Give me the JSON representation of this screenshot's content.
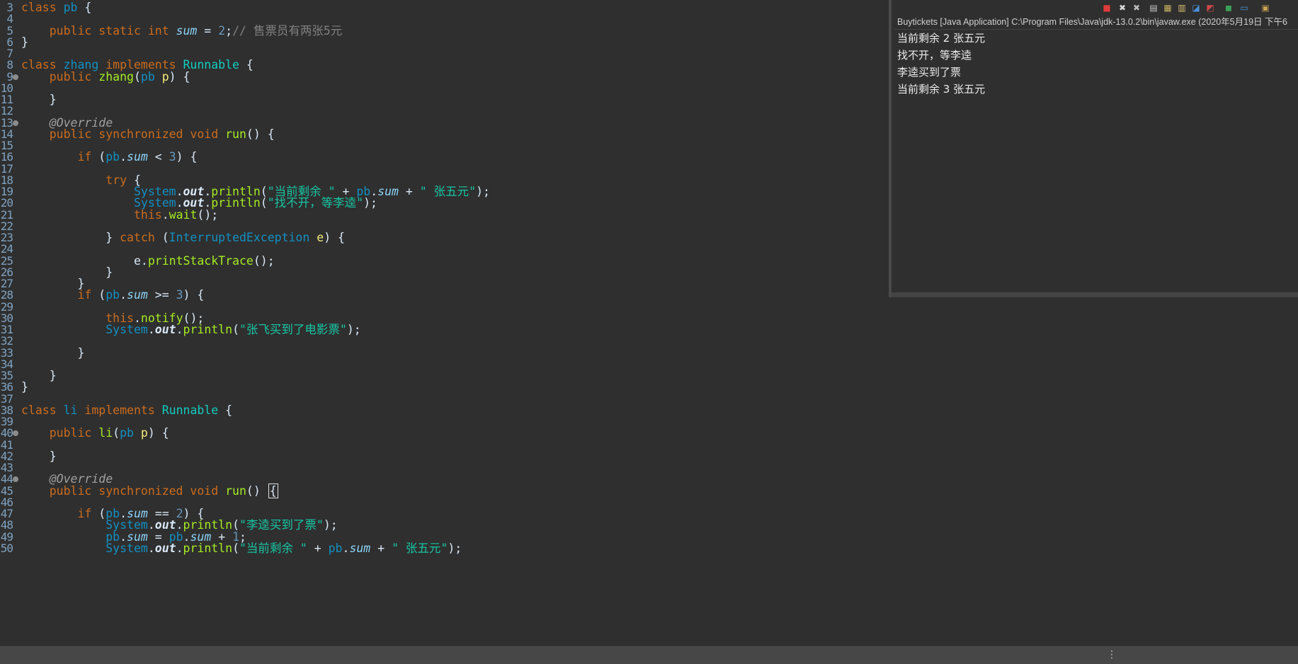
{
  "editor": {
    "lines": [
      {
        "num": "3",
        "marker": false,
        "tokens": [
          [
            "kw",
            "class "
          ],
          [
            "ty",
            "pb"
          ],
          [
            "pl",
            " {"
          ]
        ]
      },
      {
        "num": "4",
        "marker": false,
        "tokens": []
      },
      {
        "num": "5",
        "marker": false,
        "tokens": [
          [
            "pl",
            "    "
          ],
          [
            "kw",
            "public static int "
          ],
          [
            "fi",
            "sum"
          ],
          [
            "pl",
            " = "
          ],
          [
            "nm",
            "2"
          ],
          [
            "pl",
            ";"
          ],
          [
            "cm",
            "// 售票员有两张5元"
          ]
        ]
      },
      {
        "num": "6",
        "marker": false,
        "tokens": [
          [
            "pl",
            "}"
          ]
        ]
      },
      {
        "num": "7",
        "marker": false,
        "tokens": []
      },
      {
        "num": "8",
        "marker": false,
        "tokens": [
          [
            "kw",
            "class "
          ],
          [
            "ty",
            "zhang "
          ],
          [
            "kw",
            "implements "
          ],
          [
            "cls",
            "Runnable"
          ],
          [
            "pl",
            " {"
          ]
        ]
      },
      {
        "num": "9",
        "marker": true,
        "tokens": [
          [
            "pl",
            "    "
          ],
          [
            "kw",
            "public "
          ],
          [
            "mt",
            "zhang"
          ],
          [
            "pl",
            "("
          ],
          [
            "ty",
            "pb "
          ],
          [
            "vr",
            "p"
          ],
          [
            "pl",
            ") {"
          ]
        ]
      },
      {
        "num": "10",
        "marker": false,
        "tokens": []
      },
      {
        "num": "11",
        "marker": false,
        "tokens": [
          [
            "pl",
            "    }"
          ]
        ]
      },
      {
        "num": "12",
        "marker": false,
        "tokens": []
      },
      {
        "num": "13",
        "marker": true,
        "tokens": [
          [
            "pl",
            "    "
          ],
          [
            "an",
            "@Override"
          ]
        ]
      },
      {
        "num": "14",
        "marker": false,
        "tokens": [
          [
            "pl",
            "    "
          ],
          [
            "kw",
            "public synchronized void "
          ],
          [
            "mt",
            "run"
          ],
          [
            "pl",
            "() {"
          ]
        ]
      },
      {
        "num": "15",
        "marker": false,
        "tokens": []
      },
      {
        "num": "16",
        "marker": false,
        "tokens": [
          [
            "pl",
            "        "
          ],
          [
            "kw",
            "if "
          ],
          [
            "pl",
            "("
          ],
          [
            "ty",
            "pb"
          ],
          [
            "pl",
            "."
          ],
          [
            "fi",
            "sum"
          ],
          [
            "pl",
            " < "
          ],
          [
            "nm",
            "3"
          ],
          [
            "pl",
            ") {"
          ]
        ]
      },
      {
        "num": "17",
        "marker": false,
        "tokens": []
      },
      {
        "num": "18",
        "marker": false,
        "tokens": [
          [
            "pl",
            "            "
          ],
          [
            "kw",
            "try "
          ],
          [
            "pl",
            "{"
          ]
        ]
      },
      {
        "num": "19",
        "marker": false,
        "tokens": [
          [
            "pl",
            "                "
          ],
          [
            "ty",
            "System"
          ],
          [
            "pl",
            "."
          ],
          [
            "sf",
            "out"
          ],
          [
            "pl",
            "."
          ],
          [
            "mt",
            "println"
          ],
          [
            "pl",
            "("
          ],
          [
            "st",
            "\"当前剩余 \""
          ],
          [
            "pl",
            " + "
          ],
          [
            "ty",
            "pb"
          ],
          [
            "pl",
            "."
          ],
          [
            "fi",
            "sum"
          ],
          [
            "pl",
            " + "
          ],
          [
            "st",
            "\" 张五元\""
          ],
          [
            "pl",
            ");"
          ]
        ]
      },
      {
        "num": "20",
        "marker": false,
        "tokens": [
          [
            "pl",
            "                "
          ],
          [
            "ty",
            "System"
          ],
          [
            "pl",
            "."
          ],
          [
            "sf",
            "out"
          ],
          [
            "pl",
            "."
          ],
          [
            "mt",
            "println"
          ],
          [
            "pl",
            "("
          ],
          [
            "st",
            "\"找不开，等李逵\""
          ],
          [
            "pl",
            ");"
          ]
        ]
      },
      {
        "num": "21",
        "marker": false,
        "tokens": [
          [
            "pl",
            "                "
          ],
          [
            "kw",
            "this"
          ],
          [
            "pl",
            "."
          ],
          [
            "mt",
            "wait"
          ],
          [
            "pl",
            "();"
          ]
        ]
      },
      {
        "num": "22",
        "marker": false,
        "tokens": []
      },
      {
        "num": "23",
        "marker": false,
        "tokens": [
          [
            "pl",
            "            } "
          ],
          [
            "kw",
            "catch "
          ],
          [
            "pl",
            "("
          ],
          [
            "ty",
            "InterruptedException "
          ],
          [
            "vr",
            "e"
          ],
          [
            "pl",
            ") {"
          ]
        ]
      },
      {
        "num": "24",
        "marker": false,
        "tokens": []
      },
      {
        "num": "25",
        "marker": false,
        "tokens": [
          [
            "pl",
            "                "
          ],
          [
            "pl",
            "e"
          ],
          [
            "pl",
            "."
          ],
          [
            "mt",
            "printStackTrace"
          ],
          [
            "pl",
            "();"
          ]
        ]
      },
      {
        "num": "26",
        "marker": false,
        "tokens": [
          [
            "pl",
            "            }"
          ]
        ]
      },
      {
        "num": "27",
        "marker": false,
        "tokens": [
          [
            "pl",
            "        }"
          ]
        ]
      },
      {
        "num": "28",
        "marker": false,
        "tokens": [
          [
            "pl",
            "        "
          ],
          [
            "kw",
            "if "
          ],
          [
            "pl",
            "("
          ],
          [
            "ty",
            "pb"
          ],
          [
            "pl",
            "."
          ],
          [
            "fi",
            "sum"
          ],
          [
            "pl",
            " >= "
          ],
          [
            "nm",
            "3"
          ],
          [
            "pl",
            ") {"
          ]
        ]
      },
      {
        "num": "29",
        "marker": false,
        "tokens": []
      },
      {
        "num": "30",
        "marker": false,
        "tokens": [
          [
            "pl",
            "            "
          ],
          [
            "kw",
            "this"
          ],
          [
            "pl",
            "."
          ],
          [
            "mt",
            "notify"
          ],
          [
            "pl",
            "();"
          ]
        ]
      },
      {
        "num": "31",
        "marker": false,
        "tokens": [
          [
            "pl",
            "            "
          ],
          [
            "ty",
            "System"
          ],
          [
            "pl",
            "."
          ],
          [
            "sf",
            "out"
          ],
          [
            "pl",
            "."
          ],
          [
            "mt",
            "println"
          ],
          [
            "pl",
            "("
          ],
          [
            "st",
            "\"张飞买到了电影票\""
          ],
          [
            "pl",
            ");"
          ]
        ]
      },
      {
        "num": "32",
        "marker": false,
        "tokens": []
      },
      {
        "num": "33",
        "marker": false,
        "tokens": [
          [
            "pl",
            "        }"
          ]
        ]
      },
      {
        "num": "34",
        "marker": false,
        "tokens": []
      },
      {
        "num": "35",
        "marker": false,
        "tokens": [
          [
            "pl",
            "    }"
          ]
        ]
      },
      {
        "num": "36",
        "marker": false,
        "tokens": [
          [
            "pl",
            "}"
          ]
        ]
      },
      {
        "num": "37",
        "marker": false,
        "tokens": []
      },
      {
        "num": "38",
        "marker": false,
        "tokens": [
          [
            "kw",
            "class "
          ],
          [
            "ty",
            "li "
          ],
          [
            "kw",
            "implements "
          ],
          [
            "cls",
            "Runnable"
          ],
          [
            "pl",
            " {"
          ]
        ]
      },
      {
        "num": "39",
        "marker": false,
        "tokens": []
      },
      {
        "num": "40",
        "marker": true,
        "tokens": [
          [
            "pl",
            "    "
          ],
          [
            "kw",
            "public "
          ],
          [
            "mt",
            "li"
          ],
          [
            "pl",
            "("
          ],
          [
            "ty",
            "pb "
          ],
          [
            "vr",
            "p"
          ],
          [
            "pl",
            ") {"
          ]
        ]
      },
      {
        "num": "41",
        "marker": false,
        "tokens": []
      },
      {
        "num": "42",
        "marker": false,
        "tokens": [
          [
            "pl",
            "    }"
          ]
        ]
      },
      {
        "num": "43",
        "marker": false,
        "tokens": []
      },
      {
        "num": "44",
        "marker": true,
        "tokens": [
          [
            "pl",
            "    "
          ],
          [
            "an",
            "@Override"
          ]
        ]
      },
      {
        "num": "45",
        "marker": false,
        "tokens": [
          [
            "pl",
            "    "
          ],
          [
            "kw",
            "public synchronized void "
          ],
          [
            "mt",
            "run"
          ],
          [
            "pl",
            "() "
          ],
          [
            "caret",
            "{"
          ]
        ]
      },
      {
        "num": "46",
        "marker": false,
        "tokens": []
      },
      {
        "num": "47",
        "marker": false,
        "tokens": [
          [
            "pl",
            "        "
          ],
          [
            "kw",
            "if "
          ],
          [
            "pl",
            "("
          ],
          [
            "ty",
            "pb"
          ],
          [
            "pl",
            "."
          ],
          [
            "fi",
            "sum"
          ],
          [
            "pl",
            " == "
          ],
          [
            "nm",
            "2"
          ],
          [
            "pl",
            ") {"
          ]
        ]
      },
      {
        "num": "48",
        "marker": false,
        "tokens": [
          [
            "pl",
            "            "
          ],
          [
            "ty",
            "System"
          ],
          [
            "pl",
            "."
          ],
          [
            "sf",
            "out"
          ],
          [
            "pl",
            "."
          ],
          [
            "mt",
            "println"
          ],
          [
            "pl",
            "("
          ],
          [
            "st",
            "\"李逵买到了票\""
          ],
          [
            "pl",
            ");"
          ]
        ]
      },
      {
        "num": "49",
        "marker": false,
        "tokens": [
          [
            "pl",
            "            "
          ],
          [
            "ty",
            "pb"
          ],
          [
            "pl",
            "."
          ],
          [
            "fi",
            "sum"
          ],
          [
            "pl",
            " = "
          ],
          [
            "ty",
            "pb"
          ],
          [
            "pl",
            "."
          ],
          [
            "fi",
            "sum"
          ],
          [
            "pl",
            " + "
          ],
          [
            "nm",
            "1"
          ],
          [
            "pl",
            ";"
          ]
        ]
      },
      {
        "num": "50",
        "marker": false,
        "tokens": [
          [
            "pl",
            "            "
          ],
          [
            "ty",
            "System"
          ],
          [
            "pl",
            "."
          ],
          [
            "sf",
            "out"
          ],
          [
            "pl",
            "."
          ],
          [
            "mt",
            "println"
          ],
          [
            "pl",
            "("
          ],
          [
            "st",
            "\"当前剩余 \""
          ],
          [
            "pl",
            " + "
          ],
          [
            "ty",
            "pb"
          ],
          [
            "pl",
            "."
          ],
          [
            "fi",
            "sum"
          ],
          [
            "pl",
            " + "
          ],
          [
            "st",
            "\" 张五元\""
          ],
          [
            "pl",
            ");"
          ]
        ]
      }
    ]
  },
  "console": {
    "title": "Buytickets [Java Application] C:\\Program Files\\Java\\jdk-13.0.2\\bin\\javaw.exe  (2020年5月19日 下午6",
    "toolbar_icons": [
      {
        "name": "terminate-icon",
        "glyph": "■",
        "color": "#e03b3b"
      },
      {
        "name": "remove-launch-icon",
        "glyph": "✖",
        "color": "#d8d8d8"
      },
      {
        "name": "remove-all-icon",
        "glyph": "✖",
        "color": "#bcbcbc"
      },
      {
        "name": "scroll-lock-icon",
        "glyph": "▤",
        "color": "#c8c8c8"
      },
      {
        "name": "word-wrap-icon",
        "glyph": "▦",
        "color": "#c8b060"
      },
      {
        "name": "show-stdout-icon",
        "glyph": "▥",
        "color": "#d8c070"
      },
      {
        "name": "pin-console-icon",
        "glyph": "◪",
        "color": "#4a90d9"
      },
      {
        "name": "show-stderr-icon",
        "glyph": "◩",
        "color": "#d04848"
      },
      {
        "name": "open-console-icon",
        "glyph": "◼",
        "color": "#3aa056"
      },
      {
        "name": "display-console-icon",
        "glyph": "▭",
        "color": "#4a90d9"
      },
      {
        "name": "new-console-icon",
        "glyph": "▣",
        "color": "#c8a050"
      }
    ],
    "output": [
      "当前剩余 2 张五元",
      "找不开，等李逵",
      "李逵买到了票",
      "当前剩余 3 张五元"
    ]
  },
  "statusbar": {
    "grip": "⋮"
  }
}
